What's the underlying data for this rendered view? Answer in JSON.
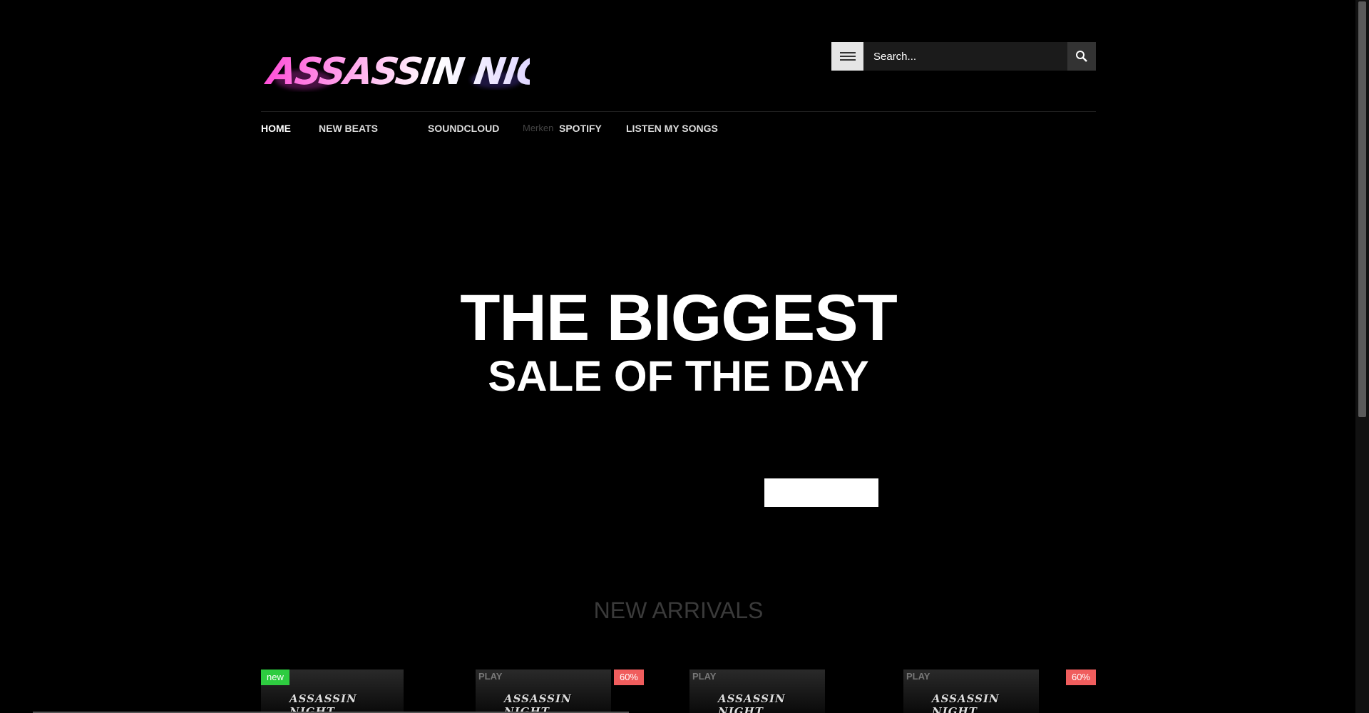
{
  "site": {
    "logo_text": "ASSASSIN NIGHT",
    "logo_icon": "brand-logo"
  },
  "search": {
    "placeholder": "Search...",
    "menu_icon": "hamburger-icon",
    "search_icon": "magnifier-icon"
  },
  "nav": {
    "items": [
      {
        "label": "HOME"
      },
      {
        "label": "NEW BEATS"
      },
      {
        "label": "SOUNDCLOUD"
      },
      {
        "label": "SPOTIFY"
      },
      {
        "label": "LISTEN MY SONGS"
      }
    ],
    "muted_text": "Merken"
  },
  "hero": {
    "title": "THE BIGGEST",
    "subtitle": "SALE OF THE DAY"
  },
  "arrivals": {
    "title": "NEW ARRIVALS",
    "products": [
      {
        "badge": "new",
        "badge_type": "new",
        "play": "",
        "brand": "ASSASSIN NIGHT"
      },
      {
        "badge": "60%",
        "badge_type": "sale",
        "play": "PLAY",
        "brand": "ASSASSIN NIGHT"
      },
      {
        "badge": "",
        "badge_type": "",
        "play": "PLAY",
        "brand": "ASSASSIN NIGHT"
      },
      {
        "badge": "60%",
        "badge_type": "sale",
        "play": "PLAY",
        "brand": "ASSASSIN NIGHT"
      }
    ]
  },
  "colors": {
    "background": "#000000",
    "new_badge": "#2ecc40",
    "sale_badge": "#f05d5d"
  }
}
